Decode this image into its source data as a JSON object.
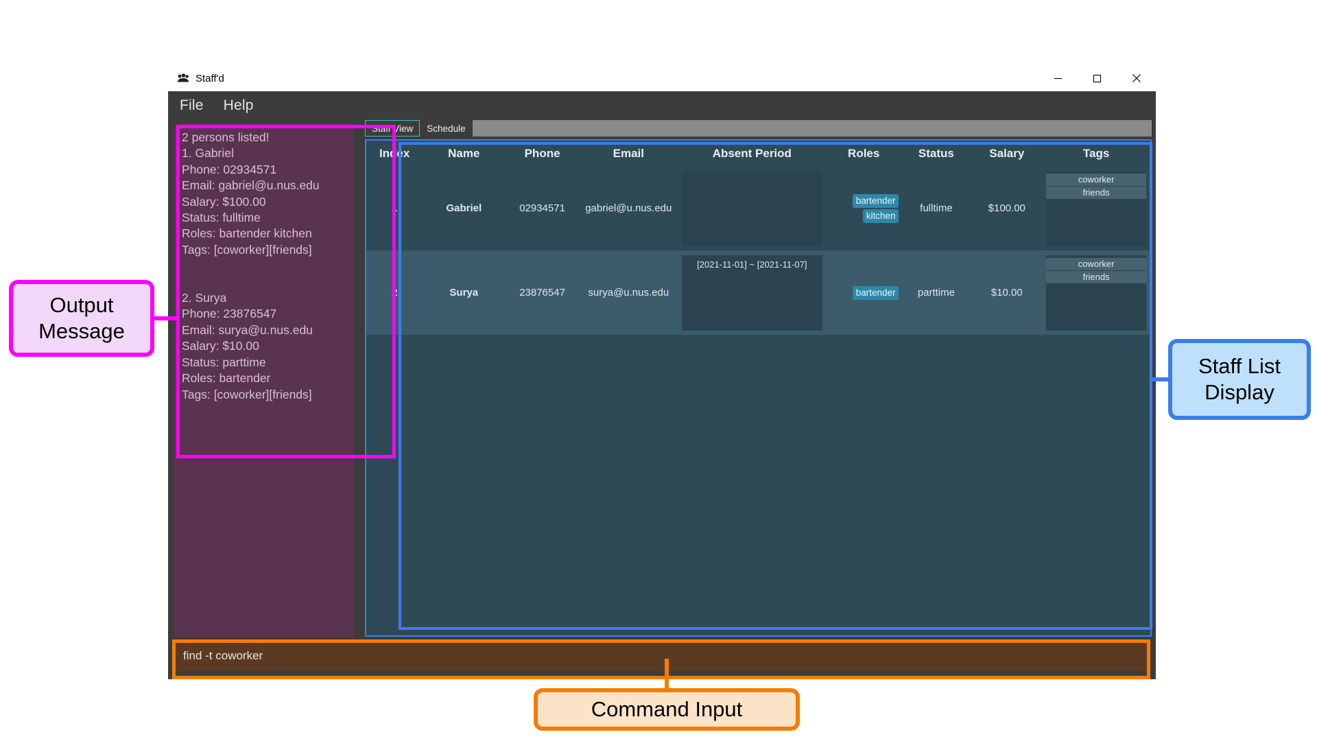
{
  "window": {
    "title": "Staff'd",
    "icon": "app-logo-icon",
    "controls": {
      "minimize": "minimize-icon",
      "maximize": "maximize-icon",
      "close": "close-icon"
    }
  },
  "menubar": {
    "items": [
      {
        "label": "File"
      },
      {
        "label": "Help"
      }
    ]
  },
  "result_display": {
    "text": "2 persons listed!\n1. Gabriel\nPhone: 02934571\nEmail: gabriel@u.nus.edu\nSalary: $100.00\nStatus: fulltime\nRoles: bartender kitchen\nTags: [coworker][friends]\n\n\n2. Surya\nPhone: 23876547\nEmail: surya@u.nus.edu\nSalary: $10.00\nStatus: parttime\nRoles: bartender\nTags: [coworker][friends]"
  },
  "tabs": [
    {
      "label": "Staff View",
      "active": true
    },
    {
      "label": "Schedule",
      "active": false
    }
  ],
  "staff_table": {
    "columns": [
      "Index",
      "Name",
      "Phone",
      "Email",
      "Absent Period",
      "Roles",
      "Status",
      "Salary",
      "Tags"
    ],
    "rows": [
      {
        "index": "1",
        "name": "Gabriel",
        "phone": "02934571",
        "email": "gabriel@u.nus.edu",
        "absent_period": "",
        "roles": [
          "bartender",
          "kitchen"
        ],
        "status": "fulltime",
        "salary": "$100.00",
        "tags": [
          "coworker",
          "friends"
        ]
      },
      {
        "index": "2",
        "name": "Surya",
        "phone": "23876547",
        "email": "surya@u.nus.edu",
        "absent_period": "[2021-11-01] ~ [2021-11-07]",
        "roles": [
          "bartender"
        ],
        "status": "parttime",
        "salary": "$10.00",
        "tags": [
          "coworker",
          "friends"
        ]
      }
    ]
  },
  "command_input": {
    "value": "find -t coworker"
  },
  "annotations": [
    {
      "label": "Output\nMessage",
      "color": "#ff00ff"
    },
    {
      "label": "Staff List\nDisplay",
      "color": "#3a7fe8"
    },
    {
      "label": "Command Input",
      "color": "#f57c00"
    }
  ],
  "colors": {
    "window_bg": "#3c3c3c",
    "result_bg": "#5a3350",
    "table_bg": "#2f4a57",
    "table_row_alt": "#3c5c6b",
    "role_chip": "#2e88a8",
    "tag_chip": "#46636f",
    "command_bg": "#5b3a23",
    "accent_blue": "#3a7fe8",
    "accent_magenta": "#ff00ff",
    "accent_orange": "#f57c00",
    "tab_active_border": "#3bbccd"
  }
}
